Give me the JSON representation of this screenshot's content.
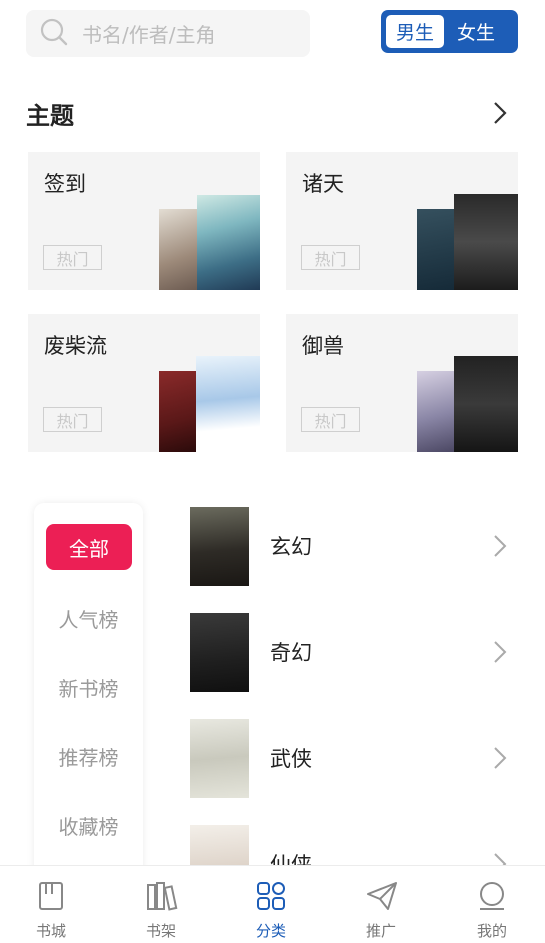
{
  "search": {
    "placeholder": "书名/作者/主角"
  },
  "gender": {
    "male": "男生",
    "female": "女生",
    "selected": "男生"
  },
  "themes": {
    "title": "主题",
    "cards": [
      {
        "name": "签到",
        "tag": "热门"
      },
      {
        "name": "诸天",
        "tag": "热门"
      },
      {
        "name": "废柴流",
        "tag": "热门"
      },
      {
        "name": "御兽",
        "tag": "热门"
      }
    ]
  },
  "ranks": {
    "items": [
      "全部",
      "人气榜",
      "新书榜",
      "推荐榜",
      "收藏榜"
    ],
    "selected": "全部"
  },
  "categories": [
    {
      "name": "玄幻"
    },
    {
      "name": "奇幻"
    },
    {
      "name": "武侠"
    },
    {
      "name": "仙侠"
    }
  ],
  "nav": {
    "items": [
      {
        "label": "书城",
        "icon": "book-icon"
      },
      {
        "label": "书架",
        "icon": "bookshelf-icon"
      },
      {
        "label": "分类",
        "icon": "category-grid-icon"
      },
      {
        "label": "推广",
        "icon": "paper-plane-icon"
      },
      {
        "label": "我的",
        "icon": "profile-icon"
      }
    ],
    "selected": "分类"
  },
  "colors": {
    "accent_blue": "#1d5db7",
    "accent_red": "#ec1f55"
  }
}
